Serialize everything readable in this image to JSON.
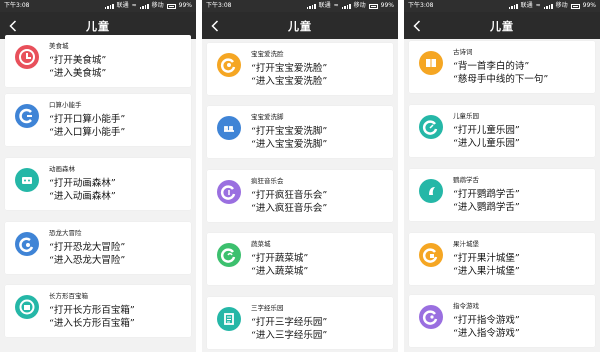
{
  "panels": [
    {
      "status": {
        "time": "下午3:08",
        "carrier1": "联通",
        "carrier2": "移动",
        "battery": "99%"
      },
      "title": "儿童",
      "items": [
        {
          "name": "美食城",
          "cmd1": "“打开美食城”",
          "cmd2": "“进入美食城”",
          "icon": "chef-icon",
          "color": "#e8505b"
        },
        {
          "name": "口算小能手",
          "cmd1": "“打开口算小能手”",
          "cmd2": "“进入口算小能手”",
          "icon": "calculator-icon",
          "color": "#3f84d6"
        },
        {
          "name": "动画森林",
          "cmd1": "“打开动画森林”",
          "cmd2": "“进入动画森林”",
          "icon": "cartoon-icon",
          "color": "#25b7a7"
        },
        {
          "name": "恐龙大冒险",
          "cmd1": "“打开恐龙大冒险”",
          "cmd2": "“进入恐龙大冒险”",
          "icon": "dinosaur-icon",
          "color": "#3f84d6"
        },
        {
          "name": "长方形百宝箱",
          "cmd1": "“打开长方形百宝箱”",
          "cmd2": "“进入长方形百宝箱”",
          "icon": "treasure-box-icon",
          "color": "#25b7a7"
        }
      ]
    },
    {
      "status": {
        "time": "下午3:08",
        "carrier1": "联通",
        "carrier2": "移动",
        "battery": "99%"
      },
      "title": "儿童",
      "items": [
        {
          "name": "宝宝爱洗脸",
          "cmd1": "“打开宝宝爱洗脸”",
          "cmd2": "“进入宝宝爱洗脸”",
          "icon": "wash-face-icon",
          "color": "#f5a623"
        },
        {
          "name": "宝宝爱洗脚",
          "cmd1": "“打开宝宝爱洗脚”",
          "cmd2": "“进入宝宝爱洗脚”",
          "icon": "wash-feet-icon",
          "color": "#3f84d6"
        },
        {
          "name": "疯狂音乐会",
          "cmd1": "“打开疯狂音乐会”",
          "cmd2": "“进入疯狂音乐会”",
          "icon": "music-icon",
          "color": "#9a6fe0"
        },
        {
          "name": "蔬菜城",
          "cmd1": "“打开蔬菜城”",
          "cmd2": "“进入蔬菜城”",
          "icon": "vegetable-icon",
          "color": "#3cc06e"
        },
        {
          "name": "三字经乐园",
          "cmd1": "“打开三字经乐园”",
          "cmd2": "“进入三字经乐园”",
          "icon": "book-scroll-icon",
          "color": "#25b7a7"
        }
      ]
    },
    {
      "status": {
        "time": "下午3:08",
        "carrier1": "联通",
        "carrier2": "移动",
        "battery": "99%"
      },
      "title": "儿童",
      "items": [
        {
          "name": "古诗词",
          "cmd1": "“背一首李白的诗”",
          "cmd2": "“慈母手中线的下一句”",
          "icon": "poetry-book-icon",
          "color": "#f5a623"
        },
        {
          "name": "儿童乐园",
          "cmd1": "“打开儿童乐园”",
          "cmd2": "“进入儿童乐园”",
          "icon": "playground-icon",
          "color": "#25b7a7"
        },
        {
          "name": "鹦鹉学舌",
          "cmd1": "“打开鹦鹉学舌”",
          "cmd2": "“进入鹦鹉学舌”",
          "icon": "parrot-icon",
          "color": "#25b7a7"
        },
        {
          "name": "果汁城堡",
          "cmd1": "“打开果汁城堡”",
          "cmd2": "“进入果汁城堡”",
          "icon": "juice-icon",
          "color": "#f5a623"
        },
        {
          "name": "指令游戏",
          "cmd1": "“打开指令游戏”",
          "cmd2": "“进入指令游戏”",
          "icon": "command-game-icon",
          "color": "#9a6fe0"
        }
      ]
    }
  ]
}
